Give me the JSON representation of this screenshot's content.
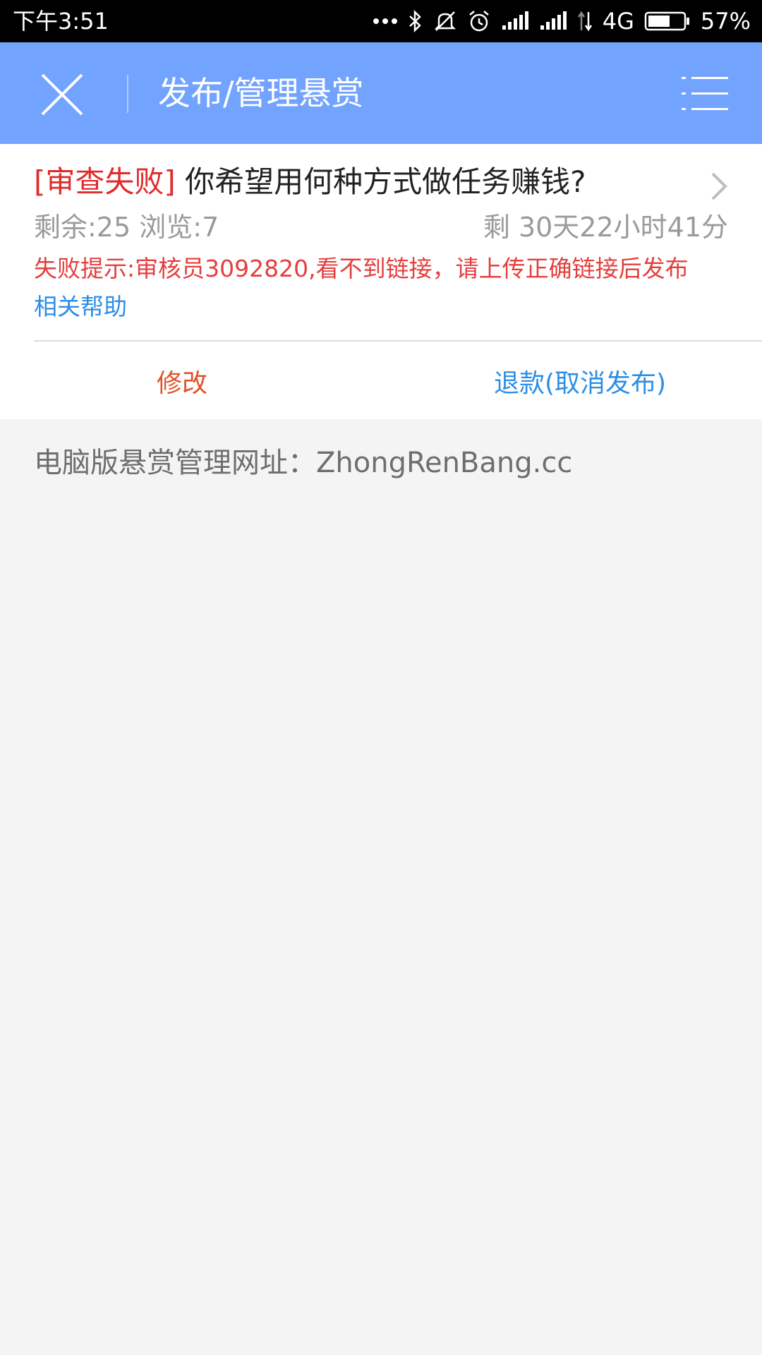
{
  "status_bar": {
    "time": "下午3:51",
    "network": "4G",
    "battery": "57%",
    "icons": [
      "more-dots-icon",
      "bluetooth-icon",
      "mute-icon",
      "alarm-icon",
      "signal-icon",
      "signal-icon",
      "data-arrows-icon",
      "battery-icon"
    ]
  },
  "header": {
    "title": "发布/管理悬赏",
    "close_icon": "close-icon",
    "menu_icon": "menu-icon",
    "background": "#72a3ff"
  },
  "task": {
    "status": "[审查失败]",
    "title": " 你希望用何种方式做任务赚钱?",
    "remaining_count": "剩余:25",
    "views": "浏览:7",
    "time_left": "剩 30天22小时41分",
    "fail_message": "失败提示:审核员3092820,看不到链接，请上传正确链接后发布",
    "help_link": "相关帮助",
    "actions": {
      "edit": "修改",
      "refund": "退款(取消发布)"
    }
  },
  "footer": {
    "pc_url_text": "电脑版悬赏管理网址：ZhongRenBang.cc"
  },
  "colors": {
    "status_fail": "#e02b2b",
    "link_blue": "#2d8ee6",
    "edit_orange": "#e0522a"
  }
}
